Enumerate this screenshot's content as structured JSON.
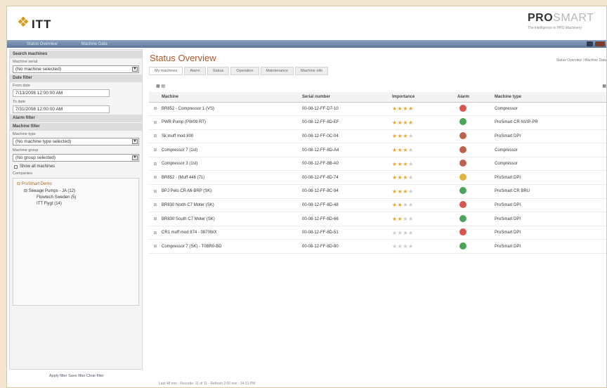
{
  "header": {
    "logo_mark": "❖",
    "logo_text": "ITT",
    "brand_bold": "PRO",
    "brand_light": "SMART",
    "brand_tagline": "The intelligence in PRO Machinery"
  },
  "nav": {
    "tabs": [
      "Status Overview",
      "Machine Data"
    ]
  },
  "sidebar": {
    "search_machines": "Search machines",
    "machine_serial_label": "Machine serial",
    "machine_serial_value": "(No machine selected)",
    "date_filter": "Date filter",
    "from_label": "From date",
    "from_value": "7/13/2008 12:00:00 AM",
    "to_label": "To date",
    "to_value": "7/31/2008 12:00:00 AM",
    "alarm_filter": "Alarm filter",
    "machine_filter": "Machine filter",
    "machine_type_label": "Machine type",
    "machine_type_value": "(No machine type selected)",
    "machine_group_label": "Machine group",
    "machine_group_value": "(No group selected)",
    "show_all_label": "Show all machines",
    "companies_label": "Companies",
    "tree": {
      "root": "ProSmart Demo",
      "child": "Sewage Pumps - JA (12)",
      "leaves": [
        "Flowtech Sweden (5)",
        "ITT Flygt (14)"
      ]
    },
    "footer": "Apply filter  Save filter  Clear filter"
  },
  "main": {
    "title": "Status Overview",
    "top_links": "Status Overview | Machine Data",
    "tabs": [
      "My machines",
      "Alarm",
      "Status",
      "Operation",
      "Maintenance",
      "Machine info"
    ],
    "columns": [
      "Machine",
      "Serial number",
      "Importance",
      "Alarm",
      "Machine type"
    ],
    "rows": [
      {
        "machine": "BR852 - Compressor 1 (VS)",
        "serial": "00-08-12-FF-D7-10",
        "stars": 4,
        "alarm": "#d9534f",
        "type": "Compressor"
      },
      {
        "machine": "PWR Pump (PW09 RT)",
        "serial": "00-08-12-FF-8D-EF",
        "stars": 4,
        "alarm": "#4aa457",
        "type": "ProSmart CR NVIP-PR"
      },
      {
        "machine": "Sk muff mod 800",
        "serial": "00-08-12-FF-0C-04",
        "stars": 3,
        "alarm": "#c0614e",
        "type": "ProSmart DPI"
      },
      {
        "machine": "Compressor 7 (1st)",
        "serial": "00-08-12-FF-8D-A4",
        "stars": 3,
        "alarm": "#c0614e",
        "type": "Compressor"
      },
      {
        "machine": "Compressor 3 (1st)",
        "serial": "00-08-12-FF-8B-A0",
        "stars": 3,
        "alarm": "#c0614e",
        "type": "Compressor"
      },
      {
        "machine": "BR852 - (Muff 446 (71)",
        "serial": "00-08-12-FF-8D-74",
        "stars": 3,
        "alarm": "#e2b43c",
        "type": "ProSmart DPI"
      },
      {
        "machine": "BPJ Pelo CR-Mi-BRP (SK)",
        "serial": "00-08-12-FF-8C-94",
        "stars": 3,
        "alarm": "#4aa457",
        "type": "ProSmart CR BRU"
      },
      {
        "machine": "BR830 North C7 Moter (SK)",
        "serial": "00-08-12-FF-8D-48",
        "stars": 2,
        "alarm": "#d9534f",
        "type": "ProSmart DPI"
      },
      {
        "machine": "BR830 South C7 Moter (SK)",
        "serial": "00-08-12-FF-8D-66",
        "stars": 2,
        "alarm": "#4aa457",
        "type": "ProSmart DPI"
      },
      {
        "machine": "CR1 muff mod 874 - 0870WX",
        "serial": "00-08-12-FF-8D-51",
        "stars": 0,
        "alarm": "#d9534f",
        "type": "ProSmart DPI"
      },
      {
        "machine": "Compressor 7 (SK) - T0BR0-BD",
        "serial": "00-08-12-FF-8D-80",
        "stars": 0,
        "alarm": "#4aa457",
        "type": "ProSmart DPI"
      }
    ],
    "footer": "Last 48 min - Records: 11 of 11 - Refresh 2:00 min - 14:31 PM"
  }
}
